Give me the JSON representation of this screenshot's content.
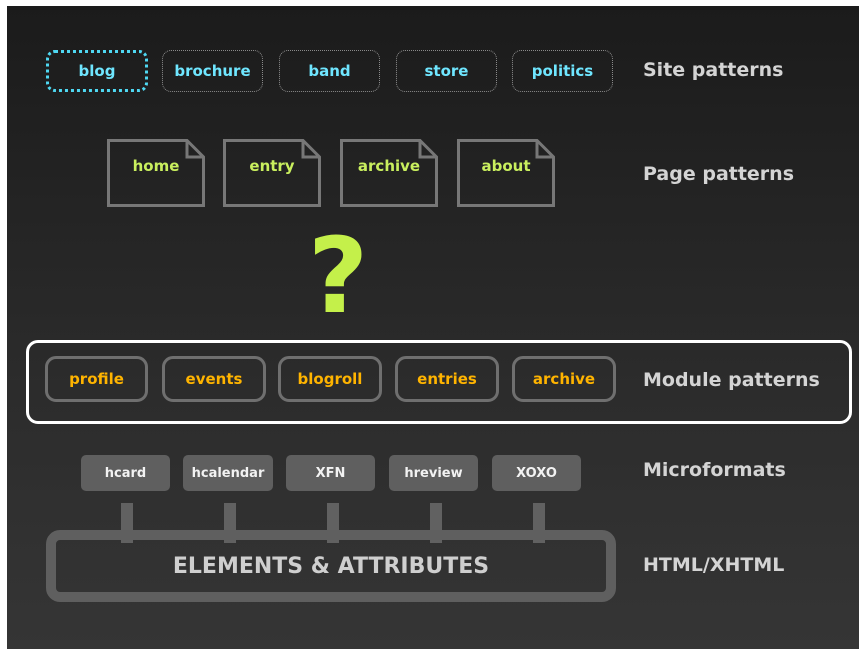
{
  "site_patterns": {
    "label": "Site patterns",
    "items": [
      "blog",
      "brochure",
      "band",
      "store",
      "politics"
    ]
  },
  "page_patterns": {
    "label": "Page patterns",
    "items": [
      "home",
      "entry",
      "archive",
      "about"
    ]
  },
  "unknown_layer": "?",
  "module_patterns": {
    "label": "Module patterns",
    "items": [
      "profile",
      "events",
      "blogroll",
      "entries",
      "archive"
    ]
  },
  "microformats": {
    "label": "Microformats",
    "items": [
      "hcard",
      "hcalendar",
      "XFN",
      "hreview",
      "XOXO"
    ]
  },
  "html_layer": {
    "label": "HTML/XHTML",
    "elements": "ELEMENTS & ATTRIBUTES"
  },
  "colors": {
    "site": "#6fe6ff",
    "page": "#c9ef5e",
    "question": "#c4f04a",
    "module": "#ffb400"
  }
}
